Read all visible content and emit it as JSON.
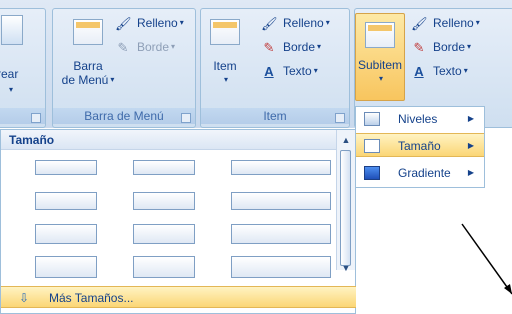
{
  "ribbon": {
    "group1": {
      "btn_label": "rear",
      "label": ""
    },
    "group2": {
      "big_label_line1": "Barra",
      "big_label_line2": "de Menú",
      "relleno": "Relleno",
      "borde": "Borde",
      "label": "Barra de Menú"
    },
    "group3": {
      "big_label": "Item",
      "relleno": "Relleno",
      "borde": "Borde",
      "texto": "Texto",
      "label": "Item"
    },
    "group4": {
      "big_label": "Subitem",
      "relleno": "Relleno",
      "borde": "Borde",
      "texto": "Texto"
    }
  },
  "dropdown": {
    "header": "Tamaño",
    "more_label": "Más Tamaños..."
  },
  "submenu": {
    "items": [
      {
        "label": "Niveles"
      },
      {
        "label": "Tamaño"
      },
      {
        "label": "Gradiente"
      }
    ]
  },
  "colors": {
    "ribbon_text": "#15428b",
    "highlight": "#fbd676"
  }
}
